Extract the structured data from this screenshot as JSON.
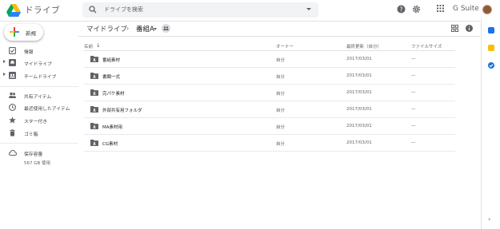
{
  "header": {
    "app_title": "ドライブ",
    "search_placeholder": "ドライブを検索",
    "suite_label": "G Suite"
  },
  "sidebar": {
    "new_button_label": "新規",
    "items": [
      {
        "label": "情報",
        "icon": "checkbox-icon"
      },
      {
        "label": "マイドライブ",
        "icon": "my-drive-icon"
      },
      {
        "label": "チームドライブ",
        "icon": "team-drive-icon"
      },
      {
        "label": "共有アイテム",
        "icon": "people-icon"
      },
      {
        "label": "最近使用したアイテム",
        "icon": "clock-icon"
      },
      {
        "label": "スター付き",
        "icon": "star-icon"
      },
      {
        "label": "ゴミ箱",
        "icon": "trash-icon"
      },
      {
        "label": "保存容量",
        "icon": "cloud-icon"
      }
    ],
    "storage_used": "567 GB 使用"
  },
  "breadcrumb": {
    "root": "マイドライブ",
    "current": "番組A"
  },
  "table": {
    "columns": {
      "name": "名前",
      "owner": "オーナー",
      "modified": "最終更新（自分）",
      "size": "ファイルサイズ"
    },
    "rows": [
      {
        "name": "番組素材",
        "owner": "自分",
        "modified": "2017/03/01",
        "size": "—"
      },
      {
        "name": "書類一式",
        "owner": "自分",
        "modified": "2017/03/01",
        "size": "—"
      },
      {
        "name": "完パケ素材",
        "owner": "自分",
        "modified": "2017/03/01",
        "size": "—"
      },
      {
        "name": "外部共有用フォルダ",
        "owner": "自分",
        "modified": "2017/03/01",
        "size": "—"
      },
      {
        "name": "MA素材用",
        "owner": "自分",
        "modified": "2017/03/01",
        "size": "—"
      },
      {
        "name": "CG素材",
        "owner": "自分",
        "modified": "2017/03/01",
        "size": "—"
      }
    ]
  },
  "colors": {
    "accent_blue": "#1a73e8",
    "folder_gray": "#5f6368",
    "side_panel_yellow": "#fbbc04"
  }
}
